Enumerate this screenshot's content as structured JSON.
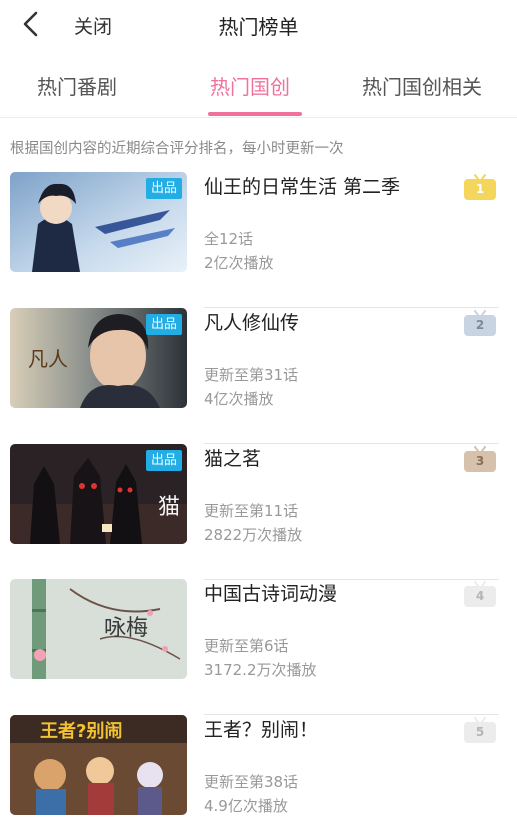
{
  "header": {
    "back_icon": "chevron-left-icon",
    "close_label": "关闭",
    "title": "热门榜单"
  },
  "tabs": [
    {
      "label": "热门番剧",
      "active": false
    },
    {
      "label": "热门国创",
      "active": true
    },
    {
      "label": "热门国创相关",
      "active": false
    }
  ],
  "accent_color": "#f0729b",
  "subtitle": "根据国创内容的近期综合评分排名，每小时更新一次",
  "items": [
    {
      "title": "仙王的日常生活 第二季",
      "eps": "全12话",
      "plays": "2亿次播放",
      "badge": "出品",
      "rank": "1",
      "rank_color": "#f5d65c"
    },
    {
      "title": "凡人修仙传",
      "eps": "更新至第31话",
      "plays": "4亿次播放",
      "badge": "出品",
      "rank": "2",
      "rank_color": "#c9d4e2"
    },
    {
      "title": "猫之茗",
      "eps": "更新至第11话",
      "plays": "2822万次播放",
      "badge": "出品",
      "rank": "3",
      "rank_color": "#d6c2ac"
    },
    {
      "title": "中国古诗词动漫",
      "eps": "更新至第6话",
      "plays": "3172.2万次播放",
      "badge": "",
      "rank": "4",
      "rank_color": "#ececec"
    },
    {
      "title": "王者？别闹！",
      "eps": "更新至第38话",
      "plays": "4.9亿次播放",
      "badge": "",
      "rank": "5",
      "rank_color": "#ececec"
    }
  ],
  "badge_color": "#23ade5"
}
